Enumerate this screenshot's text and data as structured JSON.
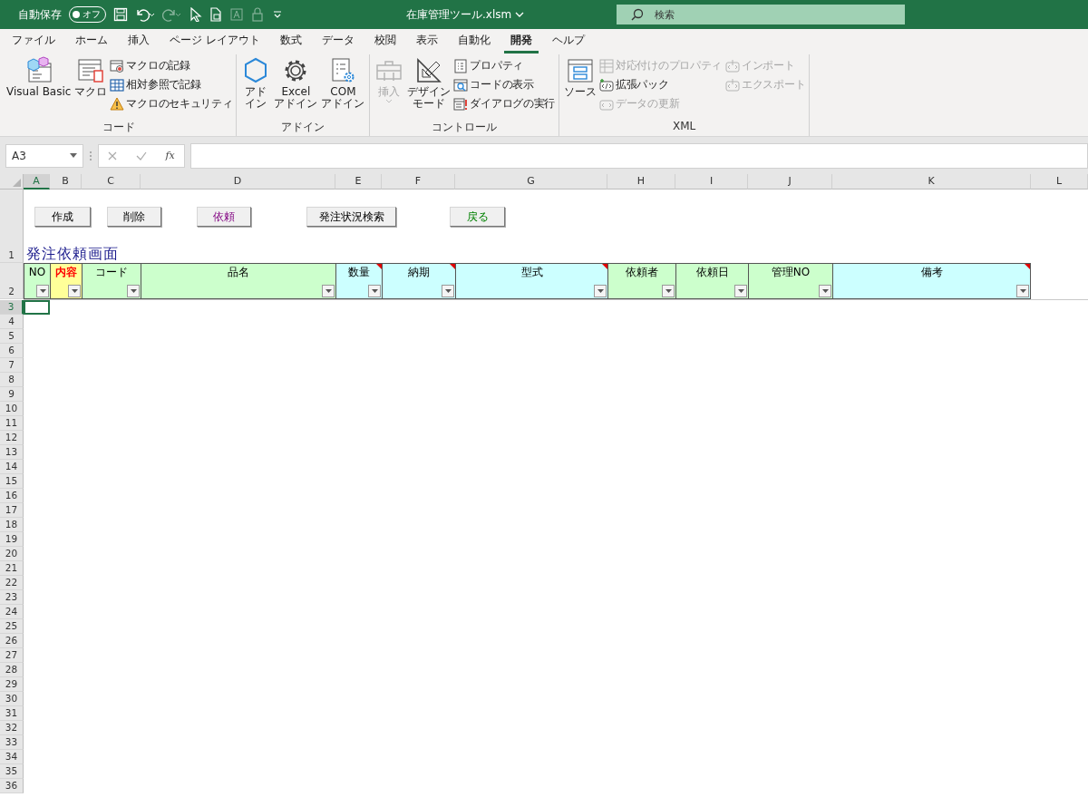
{
  "title_bar": {
    "autosave_label": "自動保存",
    "autosave_toggle": {
      "label": "オフ",
      "on": false
    },
    "file_name": "在庫管理ツール.xlsm",
    "search": {
      "placeholder": "検索"
    }
  },
  "ribbon": {
    "tabs": [
      {
        "label": "ファイル",
        "selected": false
      },
      {
        "label": "ホーム",
        "selected": false
      },
      {
        "label": "挿入",
        "selected": false
      },
      {
        "label": "ページ レイアウト",
        "selected": false
      },
      {
        "label": "数式",
        "selected": false
      },
      {
        "label": "データ",
        "selected": false
      },
      {
        "label": "校閲",
        "selected": false
      },
      {
        "label": "表示",
        "selected": false
      },
      {
        "label": "自動化",
        "selected": false
      },
      {
        "label": "開発",
        "selected": true
      },
      {
        "label": "ヘルプ",
        "selected": false
      }
    ],
    "groups": [
      {
        "name": "コード",
        "items": [
          {
            "label": "Visual Basic",
            "kind": "large",
            "disabled": false
          },
          {
            "label": "マクロ",
            "kind": "large",
            "disabled": false
          },
          {
            "label": "マクロの記録",
            "kind": "small",
            "disabled": false
          },
          {
            "label": "相対参照で記録",
            "kind": "small",
            "disabled": false
          },
          {
            "label": "マクロのセキュリティ",
            "kind": "small",
            "disabled": false
          }
        ]
      },
      {
        "name": "アドイン",
        "items": [
          {
            "label": "アドイン",
            "kind": "large",
            "disabled": false
          },
          {
            "label": "Excel\nアドイン",
            "kind": "large",
            "disabled": false
          },
          {
            "label": "COM\nアドイン",
            "kind": "large",
            "disabled": false
          }
        ]
      },
      {
        "name": "コントロール",
        "items": [
          {
            "label": "挿入",
            "kind": "large",
            "disabled": true
          },
          {
            "label": "デザインモード",
            "kind": "large",
            "disabled": false
          },
          {
            "label": "プロパティ",
            "kind": "small",
            "disabled": false
          },
          {
            "label": "コードの表示",
            "kind": "small",
            "disabled": false
          },
          {
            "label": "ダイアログの実行",
            "kind": "small",
            "disabled": false
          }
        ]
      },
      {
        "name": "XML",
        "items": [
          {
            "label": "ソース",
            "kind": "large",
            "disabled": false
          },
          {
            "label": "対応付けのプロパティ",
            "kind": "small",
            "disabled": true
          },
          {
            "label": "拡張パック",
            "kind": "small",
            "disabled": false
          },
          {
            "label": "データの更新",
            "kind": "small",
            "disabled": true
          },
          {
            "label": "インポート",
            "kind": "small",
            "disabled": true
          },
          {
            "label": "エクスポート",
            "kind": "small",
            "disabled": true
          }
        ]
      }
    ]
  },
  "formula_bar": {
    "name_box": "A3",
    "function_label": "fx"
  },
  "sheet": {
    "columns": [
      {
        "letter": "A",
        "selected": true
      },
      {
        "letter": "B",
        "selected": false
      },
      {
        "letter": "C",
        "selected": false
      },
      {
        "letter": "D",
        "selected": false
      },
      {
        "letter": "E",
        "selected": false
      },
      {
        "letter": "F",
        "selected": false
      },
      {
        "letter": "G",
        "selected": false
      },
      {
        "letter": "H",
        "selected": false
      },
      {
        "letter": "I",
        "selected": false
      },
      {
        "letter": "J",
        "selected": false
      },
      {
        "letter": "K",
        "selected": false
      },
      {
        "letter": "L",
        "selected": false
      }
    ],
    "buttons": [
      {
        "label": "作成"
      },
      {
        "label": "削除"
      },
      {
        "label": "依頼",
        "color": "#800080"
      },
      {
        "label": "発注状況検索"
      },
      {
        "label": "戻る",
        "color": "#008000"
      }
    ],
    "title": "発注依頼画面",
    "headers": [
      {
        "label": "NO",
        "color": "#ccffcc",
        "emphasized": false,
        "comment": false
      },
      {
        "label": "内容",
        "color": "#ffff99",
        "emphasized": true,
        "comment": false
      },
      {
        "label": "コード",
        "color": "#ccffcc",
        "emphasized": false,
        "comment": false
      },
      {
        "label": "品名",
        "color": "#ccffcc",
        "emphasized": false,
        "comment": false
      },
      {
        "label": "数量",
        "color": "#ccffff",
        "emphasized": false,
        "comment": true
      },
      {
        "label": "納期",
        "color": "#ccffff",
        "emphasized": false,
        "comment": true
      },
      {
        "label": "型式",
        "color": "#ccffff",
        "emphasized": false,
        "comment": true
      },
      {
        "label": "依頼者",
        "color": "#ccffcc",
        "emphasized": false,
        "comment": false
      },
      {
        "label": "依頼日",
        "color": "#ccffcc",
        "emphasized": false,
        "comment": false
      },
      {
        "label": "管理NO",
        "color": "#ccffcc",
        "emphasized": false,
        "comment": false
      },
      {
        "label": "備考",
        "color": "#ccffff",
        "emphasized": false,
        "comment": true
      }
    ],
    "rows": [
      {
        "number": "1",
        "selected": false
      },
      {
        "number": "2",
        "selected": false
      },
      {
        "number": "3",
        "selected": true
      },
      {
        "number": "4",
        "selected": false
      },
      {
        "number": "5",
        "selected": false
      },
      {
        "number": "6",
        "selected": false
      },
      {
        "number": "7",
        "selected": false
      },
      {
        "number": "8",
        "selected": false
      },
      {
        "number": "9",
        "selected": false
      },
      {
        "number": "10",
        "selected": false
      },
      {
        "number": "11",
        "selected": false
      },
      {
        "number": "12",
        "selected": false
      },
      {
        "number": "13",
        "selected": false
      },
      {
        "number": "14",
        "selected": false
      },
      {
        "number": "15",
        "selected": false
      },
      {
        "number": "16",
        "selected": false
      },
      {
        "number": "17",
        "selected": false
      },
      {
        "number": "18",
        "selected": false
      },
      {
        "number": "19",
        "selected": false
      },
      {
        "number": "20",
        "selected": false
      },
      {
        "number": "21",
        "selected": false
      },
      {
        "number": "22",
        "selected": false
      },
      {
        "number": "23",
        "selected": false
      },
      {
        "number": "24",
        "selected": false
      },
      {
        "number": "25",
        "selected": false
      },
      {
        "number": "26",
        "selected": false
      },
      {
        "number": "27",
        "selected": false
      },
      {
        "number": "28",
        "selected": false
      },
      {
        "number": "29",
        "selected": false
      },
      {
        "number": "30",
        "selected": false
      },
      {
        "number": "31",
        "selected": false
      },
      {
        "number": "32",
        "selected": false
      },
      {
        "number": "33",
        "selected": false
      },
      {
        "number": "34",
        "selected": false
      },
      {
        "number": "35",
        "selected": false
      },
      {
        "number": "36",
        "selected": false
      }
    ]
  }
}
